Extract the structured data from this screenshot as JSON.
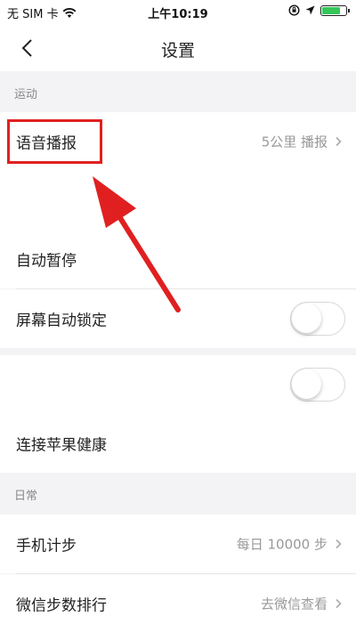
{
  "status_bar": {
    "carrier": "无 SIM 卡",
    "time": "上午10:19",
    "battery_level": 0.7
  },
  "nav": {
    "title": "设置"
  },
  "sections": {
    "sport": {
      "header": "运动",
      "voice_broadcast": {
        "label": "语音播报",
        "value": "5公里 播报"
      },
      "auto_pause": {
        "label": "自动暂停"
      },
      "screen_lock": {
        "label": "屏幕自动锁定",
        "enabled": false
      },
      "unnamed_toggle": {
        "enabled": false
      },
      "apple_health": {
        "label": "连接苹果健康"
      }
    },
    "daily": {
      "header": "日常",
      "step_count": {
        "label": "手机计步",
        "value": "每日 10000 步"
      },
      "wechat_rank": {
        "label": "微信步数排行",
        "value": "去微信查看"
      }
    }
  },
  "colors": {
    "highlight": "#e02020",
    "background": "#f3f3f5",
    "battery": "#35c759"
  }
}
